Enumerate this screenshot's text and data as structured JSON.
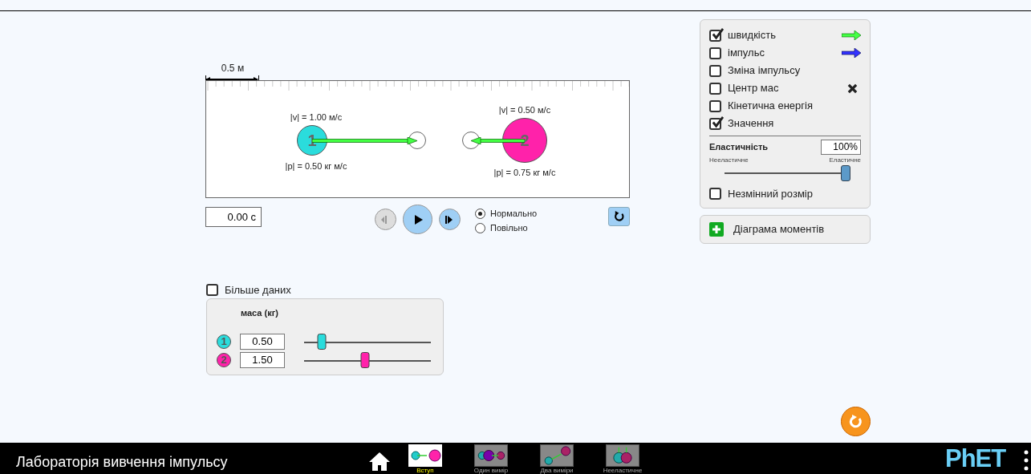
{
  "scale_label": "0.5 м",
  "balls": [
    {
      "number": "1",
      "color": "#2adcdc",
      "v_label": "|v| = 1.00 м/с",
      "p_label": "|p| = 0.50 кг м/с"
    },
    {
      "number": "2",
      "color": "#ff22aa",
      "v_label": "|v| = 0.50 м/с",
      "p_label": "|p| = 0.75 кг м/с"
    }
  ],
  "time": "0.00 с",
  "speed_options": [
    {
      "label": "Нормально",
      "selected": true
    },
    {
      "label": "Повільно",
      "selected": false
    }
  ],
  "options": [
    {
      "label": "швидкість",
      "checked": true,
      "kind": "green-arrow"
    },
    {
      "label": "імпульс",
      "checked": false,
      "kind": "blue-arrow"
    },
    {
      "label": "Зміна імпульсу",
      "checked": false,
      "kind": "plain"
    },
    {
      "label": "Центр мас",
      "checked": false,
      "kind": "cross"
    },
    {
      "label": "Кінетична енергія",
      "checked": false,
      "kind": "plain"
    },
    {
      "label": "Значення",
      "checked": true,
      "kind": "plain"
    }
  ],
  "elasticity": {
    "title": "Еластичність",
    "value": "100%",
    "min_label": "Нееластичне",
    "max_label": "Еластичне",
    "level": 1
  },
  "constant_size": {
    "label": "Незмінний розмір",
    "checked": false
  },
  "momenta_diagram": {
    "label": "Діаграма моментів"
  },
  "more_data": {
    "label": "Більше даних",
    "checked": false
  },
  "mass_panel": {
    "title": "маса (кг)",
    "rows": [
      {
        "number": "1",
        "value": "0.50",
        "level": 0.14
      },
      {
        "number": "2",
        "value": "1.50",
        "level": 0.48
      }
    ]
  },
  "nav": {
    "title": "Лабораторія вивчення імпульсу",
    "brand": "PhET",
    "tabs": [
      {
        "label": "Вступ",
        "selected": true
      },
      {
        "label": "Один вимір",
        "selected": false
      },
      {
        "label": "Два виміри",
        "selected": false
      },
      {
        "label": "Нееластичне",
        "selected": false
      }
    ]
  }
}
